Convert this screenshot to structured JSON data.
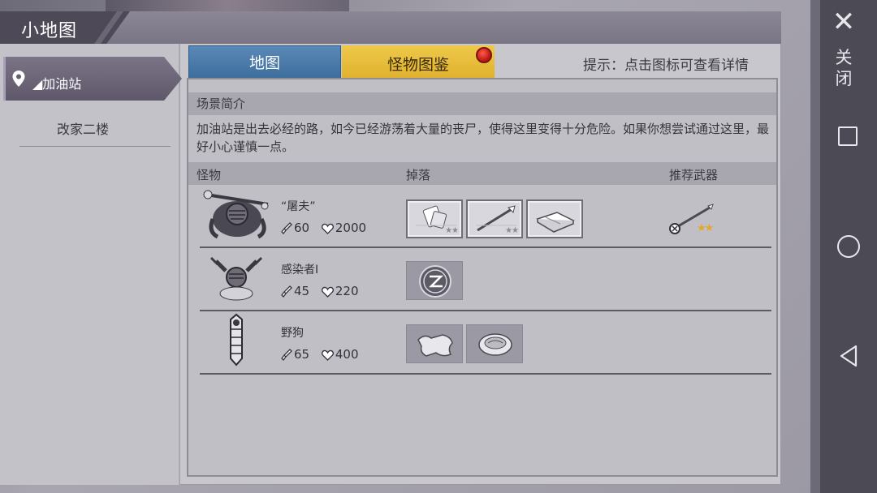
{
  "window": {
    "title": "小地图",
    "close_label": "关闭"
  },
  "sidebar": {
    "selected_location": "◢加油站",
    "items": [
      {
        "label": "改家二楼"
      }
    ]
  },
  "tabs": [
    {
      "label": "地图"
    },
    {
      "label": "怪物图鉴"
    }
  ],
  "hint": "提示：点击图标可查看详情",
  "scene": {
    "header": "场景简介",
    "description": "加油站是出去必经的路，如今已经游荡着大量的丧尸，使得这里变得十分危险。如果你想尝试通过这里，最好小心谨慎一点。"
  },
  "columns": {
    "monster": "怪物",
    "drops": "掉落",
    "weapon": "推荐武器"
  },
  "monsters": [
    {
      "name": "“屠夫”",
      "attack": "60",
      "hp": "2000",
      "drops": [
        {
          "icon": "bandage-icon",
          "stars": "★★"
        },
        {
          "icon": "spear-icon",
          "stars": "★★"
        },
        {
          "icon": "book-icon",
          "stars": "★★"
        }
      ],
      "weapon": {
        "icon": "spear-weapon-icon",
        "stars": "★★"
      }
    },
    {
      "name": "感染者I",
      "attack": "45",
      "hp": "220",
      "drops": [
        {
          "icon": "coin-icon",
          "stars": ""
        }
      ]
    },
    {
      "name": "野狗",
      "attack": "65",
      "hp": "400",
      "drops": [
        {
          "icon": "hide-icon",
          "stars": ""
        },
        {
          "icon": "meat-icon",
          "stars": ""
        }
      ]
    }
  ],
  "colors": {
    "tab_map": "#4a7aab",
    "tab_monster": "#e3b733",
    "notification": "#d8231a",
    "star_gold": "#e2a82a"
  }
}
